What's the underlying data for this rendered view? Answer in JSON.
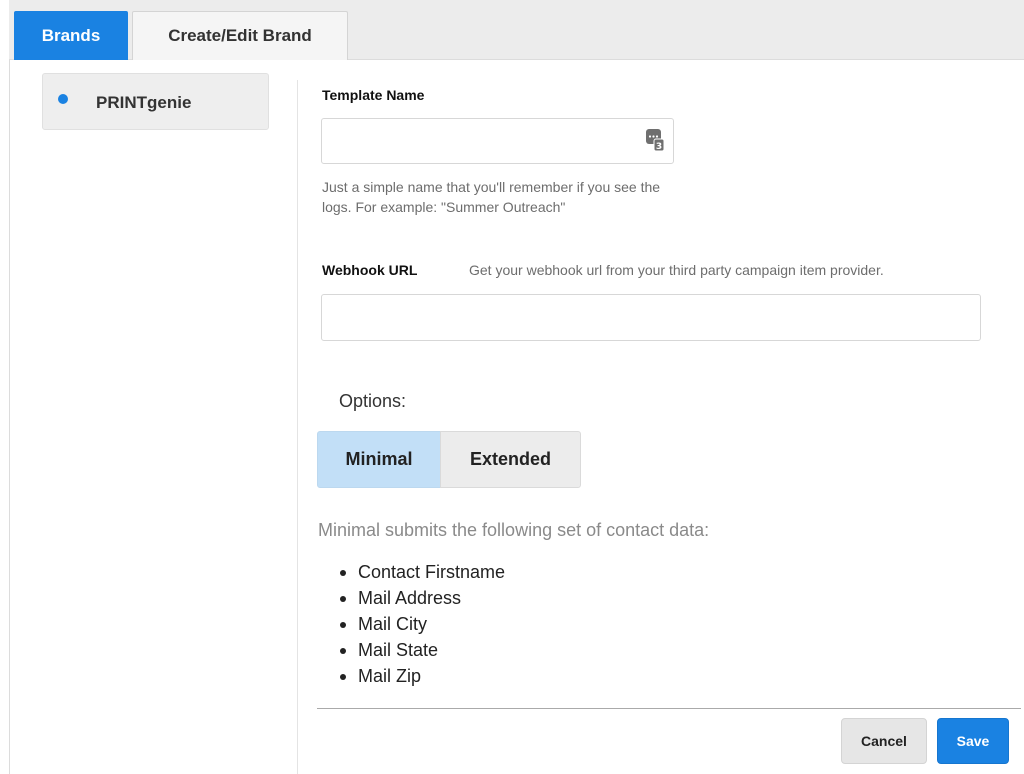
{
  "tabs": [
    {
      "label": "Brands",
      "active": true
    },
    {
      "label": "Create/Edit Brand",
      "active": false
    }
  ],
  "brands": [
    {
      "label": "PRINTgenie",
      "selected": true
    }
  ],
  "form": {
    "template_name": {
      "label": "Template Name",
      "value": "",
      "help": "Just a simple name that you'll remember if you see the logs. For example: \"Summer Outreach\"",
      "icon": "password-manager-icon"
    },
    "webhook_url": {
      "label": "Webhook URL",
      "help": "Get your webhook url from your third party campaign item provider.",
      "value": ""
    },
    "options": {
      "label": "Options:",
      "choices": [
        "Minimal",
        "Extended"
      ],
      "selected": "Minimal"
    },
    "summary": "Minimal submits the following set of contact data:",
    "fields": [
      "Contact Firstname",
      "Mail Address",
      "Mail City",
      "Mail State",
      "Mail Zip"
    ]
  },
  "actions": {
    "cancel": "Cancel",
    "save": "Save"
  },
  "colors": {
    "accent": "#1a82e2",
    "selected_option": "#c2dff7"
  }
}
